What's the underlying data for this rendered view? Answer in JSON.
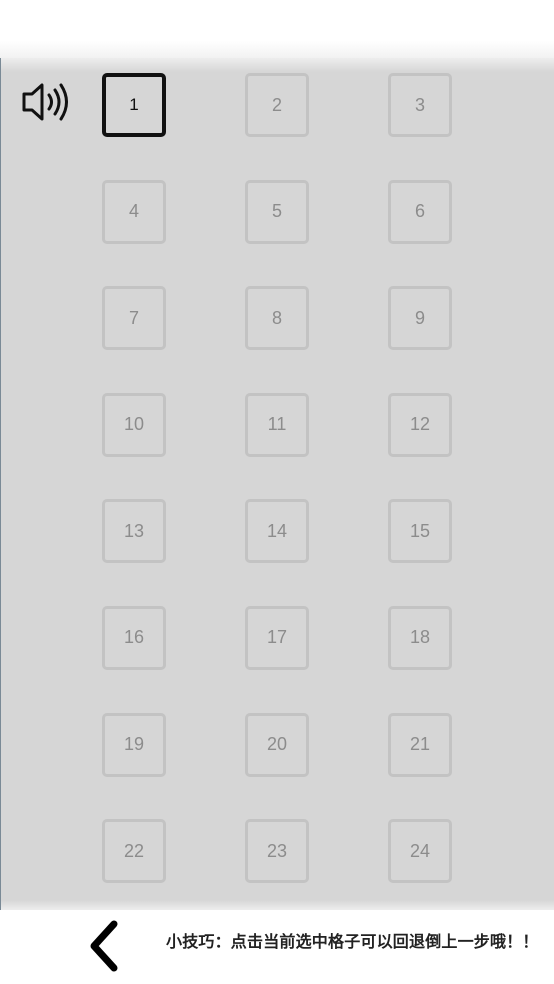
{
  "board": {
    "selected_level": "1",
    "cells": [
      "1",
      "2",
      "3",
      "4",
      "5",
      "6",
      "7",
      "8",
      "9",
      "10",
      "11",
      "12",
      "13",
      "14",
      "15",
      "16",
      "17",
      "18",
      "19",
      "20",
      "21",
      "22",
      "23",
      "24"
    ]
  },
  "icons": {
    "sound": "speaker-volume-icon",
    "back": "chevron-left-icon"
  },
  "footer": {
    "tip": "小技巧：点击当前选中格子可以回退倒上一步哦！！"
  },
  "colors": {
    "board_background": "#d6d6d6",
    "cell_border": "#c3c3c3",
    "cell_text": "#8c8c8c",
    "selected_border": "#111111"
  }
}
